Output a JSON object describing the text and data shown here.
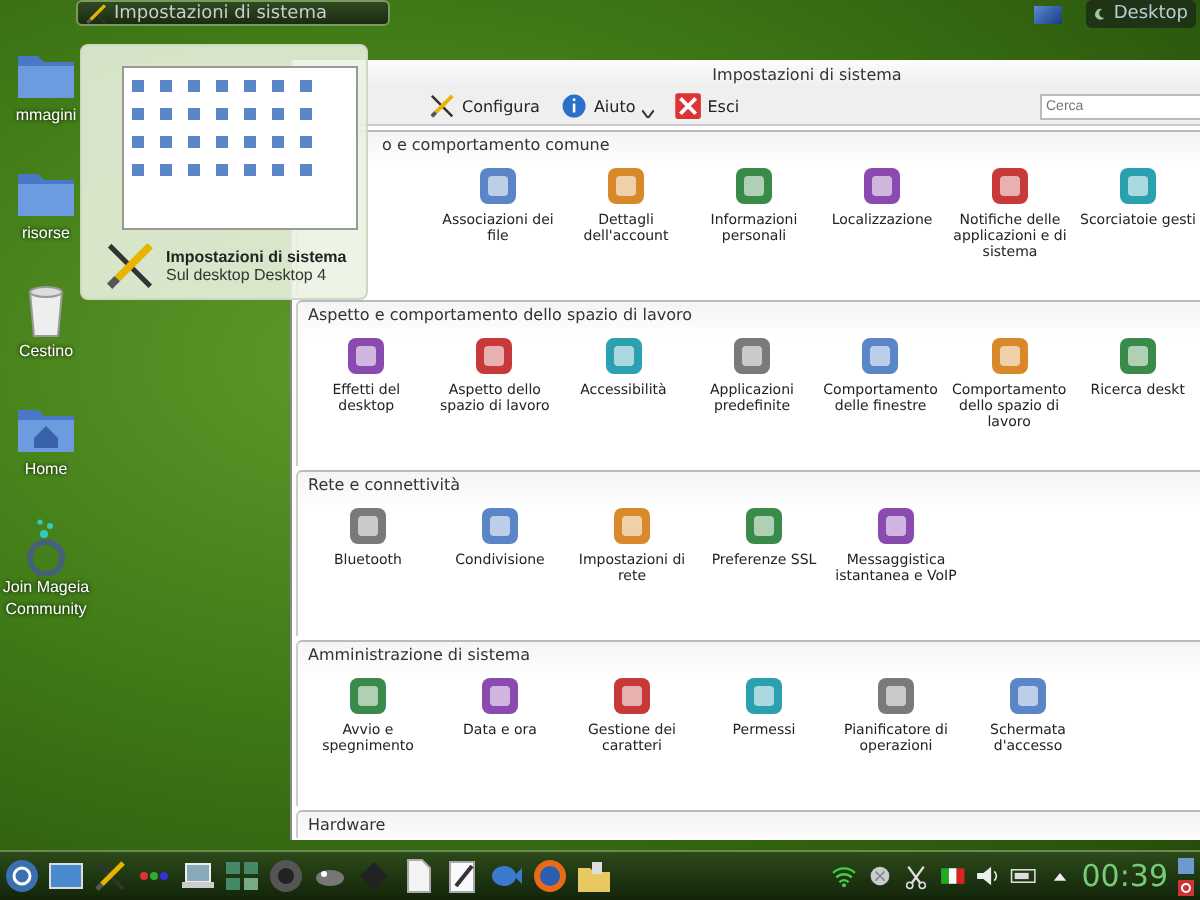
{
  "top_panel": {
    "task_title": "Impostazioni di sistema",
    "desktop_label": "Desktop"
  },
  "desktop_icons": [
    {
      "kind": "folder",
      "label": "mmagini"
    },
    {
      "kind": "folder",
      "label": "risorse"
    },
    {
      "kind": "trash",
      "label": "Cestino"
    },
    {
      "kind": "home",
      "label": "Home"
    },
    {
      "kind": "community",
      "label": "Join Mageia Community"
    }
  ],
  "tooltip": {
    "title": "Impostazioni di sistema",
    "subtitle": "Sul desktop Desktop 4"
  },
  "window": {
    "title": "Impostazioni di sistema",
    "toolbar": [
      {
        "kind": "configure",
        "label": "Configura"
      },
      {
        "kind": "help",
        "label": "Aiuto"
      },
      {
        "kind": "quit",
        "label": "Esci"
      }
    ],
    "search": {
      "placeholder": "Cerca"
    },
    "sections": [
      {
        "title": "o e comportamento comune",
        "items": [
          "Associazioni dei file",
          "Dettagli dell'account",
          "Informazioni personali",
          "Localizzazione",
          "Notifiche delle applicazioni e di sistema",
          "Scorciatoie gesti"
        ]
      },
      {
        "title": "Aspetto e comportamento dello spazio di lavoro",
        "items": [
          "Effetti del desktop",
          "Aspetto dello spazio di lavoro",
          "Accessibilità",
          "Applicazioni predefinite",
          "Comportamento delle finestre",
          "Comportamento dello spazio di lavoro",
          "Ricerca deskt"
        ]
      },
      {
        "title": "Rete e connettività",
        "items": [
          "Bluetooth",
          "Condivisione",
          "Impostazioni di rete",
          "Preferenze SSL",
          "Messaggistica istantanea e VoIP"
        ]
      },
      {
        "title": "Amministrazione di sistema",
        "items": [
          "Avvio e spegnimento",
          "Data e ora",
          "Gestione dei caratteri",
          "Permessi",
          "Pianificatore di operazioni",
          "Schermata d'accesso"
        ]
      },
      {
        "title": "Hardware"
      }
    ]
  },
  "taskbar": {
    "clock": "00:39"
  }
}
